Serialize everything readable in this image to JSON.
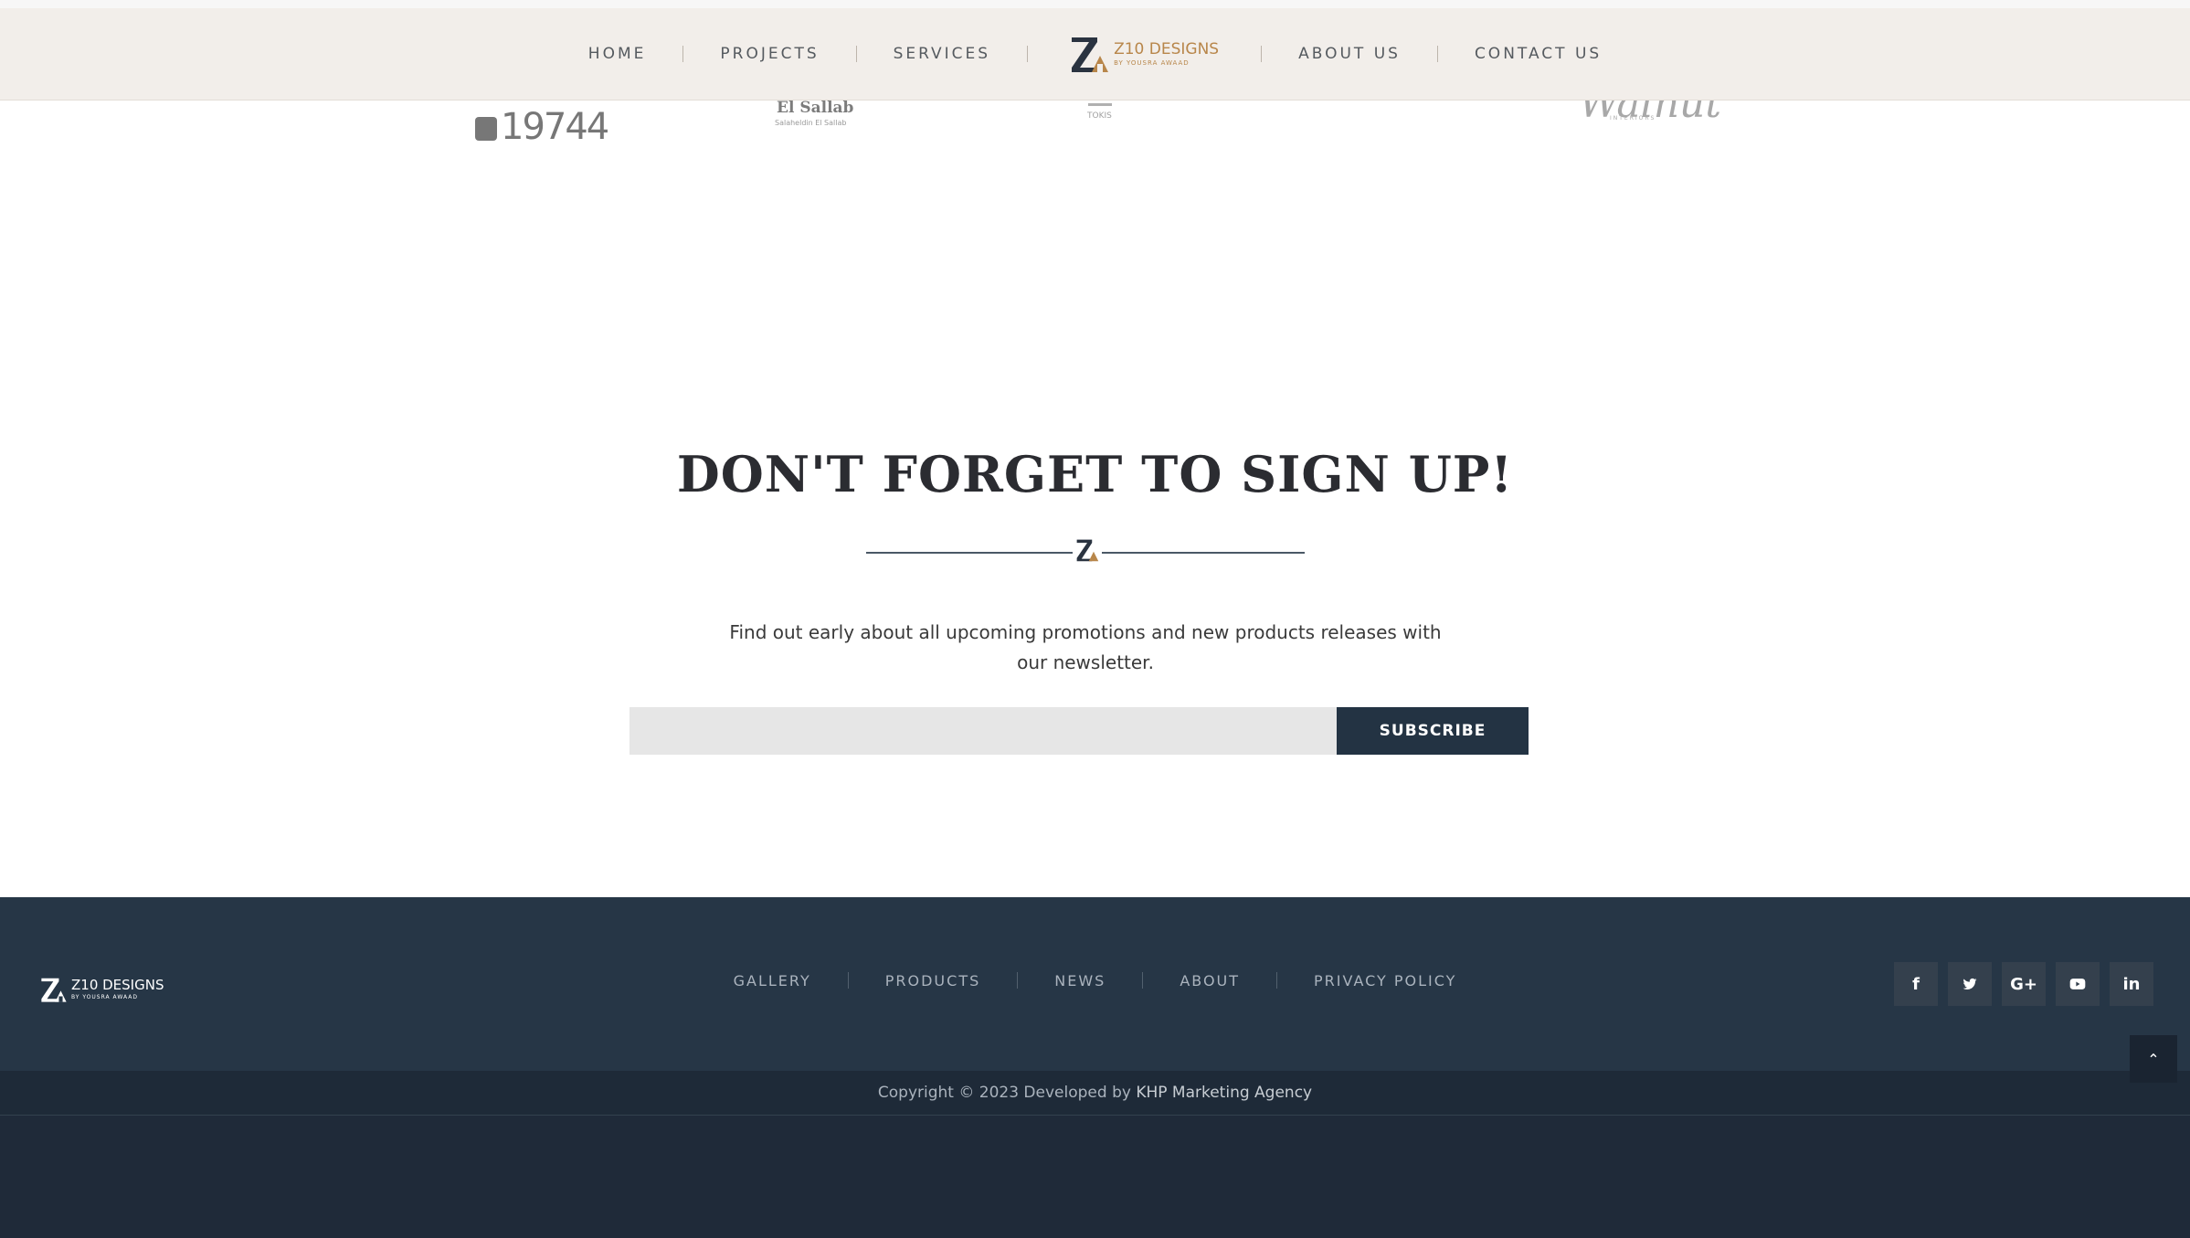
{
  "header": {
    "nav_left": [
      "HOME",
      "PROJECTS",
      "SERVICES"
    ],
    "nav_right": [
      "ABOUT US",
      "CONTACT US"
    ],
    "logo": {
      "title": "Z10 DESIGNS",
      "subtitle": "BY YOUSRA AWAAD"
    }
  },
  "partners": {
    "hotline": "19744",
    "elsallab": "El Sallab",
    "elsallab_sub": "Salaheldin El Sallab",
    "p3": "TOKIS",
    "walnut": "Walnut",
    "walnut_sub": "INTERIORS"
  },
  "newsletter": {
    "title": "DON'T FORGET TO SIGN UP!",
    "divider_mark": "Z",
    "description": "Find out early about all upcoming promotions and new products releases with our newsletter.",
    "email_value": "",
    "email_placeholder": "",
    "subscribe_label": "SUBSCRIBE"
  },
  "footer": {
    "logo": {
      "title": "Z10 DESIGNS",
      "subtitle": "BY YOUSRA AWAAD"
    },
    "links": [
      "GALLERY",
      "PRODUCTS",
      "NEWS",
      "ABOUT",
      "PRIVACY POLICY"
    ],
    "social": [
      {
        "icon": "facebook-icon",
        "glyph": "f"
      },
      {
        "icon": "twitter-icon",
        "glyph": "t"
      },
      {
        "icon": "google-plus-icon",
        "glyph": "G+"
      },
      {
        "icon": "youtube-icon",
        "glyph": "▶"
      },
      {
        "icon": "linkedin-icon",
        "glyph": "in"
      }
    ],
    "copyright_prefix": "Copyright © 2023 Developed by",
    "copyright_link": "KHP Marketing Agency",
    "back_to_top": "⌃"
  },
  "colors": {
    "header_bg": "#f2eeea",
    "brand_gold": "#b8864a",
    "brand_navy": "#233343",
    "footer_bg": "#263646",
    "copyright_bg": "#1e2a38"
  }
}
